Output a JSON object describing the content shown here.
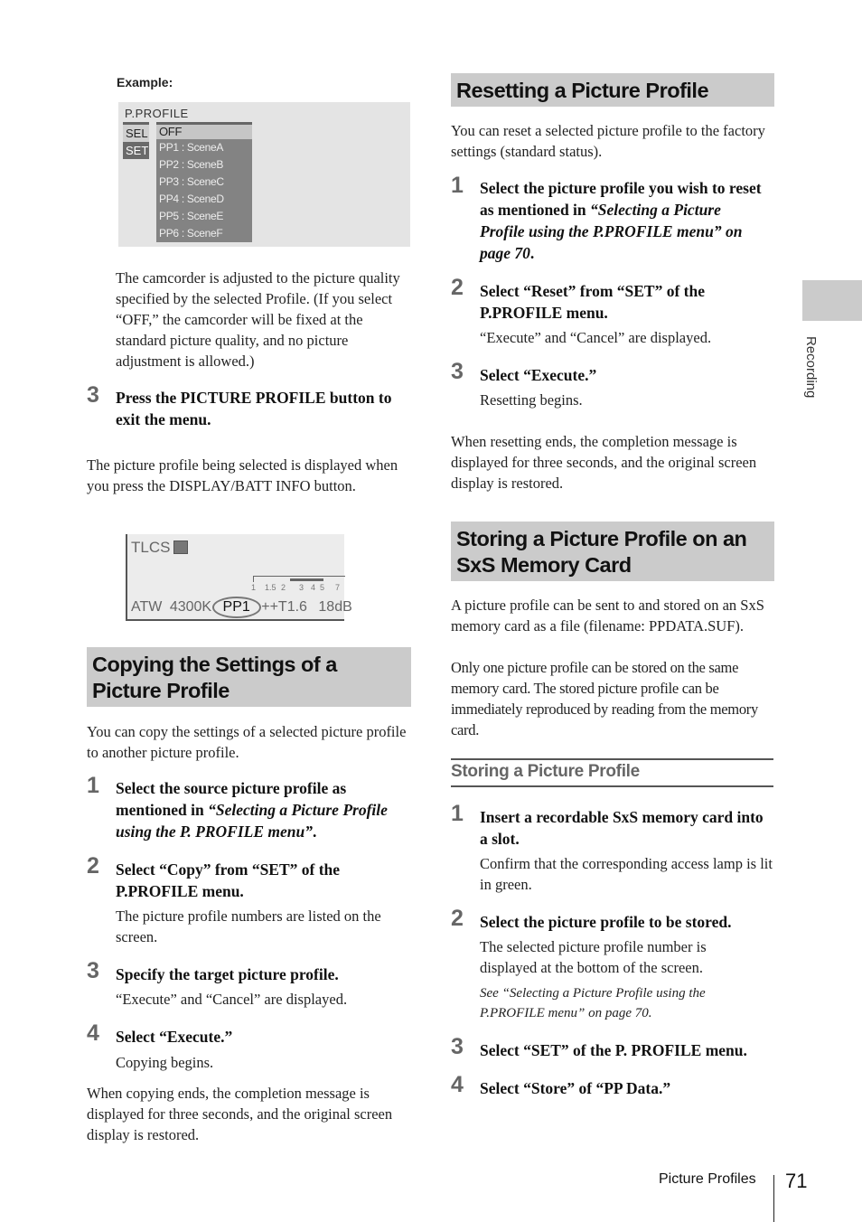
{
  "example": {
    "label": "Example:",
    "menu": {
      "title": "P.PROFILE",
      "tabs": [
        "SEL",
        "SET"
      ],
      "items": [
        "OFF",
        "PP1 : SceneA",
        "PP2 : SceneB",
        "PP3 : SceneC",
        "PP4 : SceneD",
        "PP5 : SceneE",
        "PP6 : SceneF"
      ]
    }
  },
  "left": {
    "para1": "The camcorder is adjusted to the picture quality specified by the selected Profile. (If you select “OFF,” the camcorder will be fixed at the standard picture quality, and no picture adjustment is allowed.)",
    "step3": {
      "num": "3",
      "title": "Press the PICTURE PROFILE button to exit the menu."
    },
    "para2": "The picture profile being selected is displayed when you press the DISPLAY/BATT INFO button.",
    "lcd": {
      "top": "TLCS",
      "scale": [
        "1",
        "1.5",
        "2",
        "3",
        "4",
        "5",
        "7"
      ],
      "bottom": [
        "ATW",
        "4300K",
        "PP1",
        "++T1.6",
        "18dB"
      ]
    },
    "copy_section": {
      "heading": "Copying the Settings of a Picture Profile",
      "intro": "You can copy the settings of a selected picture profile to another picture profile.",
      "steps": [
        {
          "num": "1",
          "title_plain": "Select the source picture profile as mentioned in ",
          "title_italic": "“Selecting a Picture Profile using the P. PROFILE menu”",
          "title_end": "."
        },
        {
          "num": "2",
          "title": "Select “Copy” from “SET” of the P.PROFILE menu.",
          "note": "The picture profile numbers are listed on the screen."
        },
        {
          "num": "3",
          "title": "Specify the target picture profile.",
          "note": "“Execute” and “Cancel” are displayed."
        },
        {
          "num": "4",
          "title": "Select “Execute.”",
          "note": "Copying begins."
        }
      ],
      "outro": "When copying ends, the completion message is displayed for three seconds, and the original screen display is restored."
    }
  },
  "right": {
    "reset_section": {
      "heading": "Resetting a Picture Profile",
      "intro": "You can reset a selected picture profile to the factory settings (standard status).",
      "steps": [
        {
          "num": "1",
          "title_plain": "Select the picture profile you wish to reset as mentioned in ",
          "title_italic": "“Selecting a Picture Profile using the P.PROFILE menu” on page 70",
          "title_end": "."
        },
        {
          "num": "2",
          "title": "Select “Reset” from “SET” of the P.PROFILE menu.",
          "note": "“Execute” and “Cancel” are displayed."
        },
        {
          "num": "3",
          "title": "Select “Execute.”",
          "note": "Resetting begins."
        }
      ],
      "outro": "When resetting ends, the completion message is displayed for three seconds, and the original screen display is restored."
    },
    "store_section": {
      "heading": "Storing a Picture Profile on an SxS Memory Card",
      "intro1": "A picture profile can be sent to and stored on an SxS memory card as a file (filename: PPDATA.SUF).",
      "intro2": "Only one picture profile can be stored on the same memory card. The stored picture profile can be immediately reproduced by reading from the memory card.",
      "subheading": "Storing a Picture Profile",
      "steps": [
        {
          "num": "1",
          "title": "Insert a recordable SxS memory card into a slot.",
          "note": "Confirm that the corresponding access lamp is lit in green."
        },
        {
          "num": "2",
          "title": "Select the picture profile to be stored.",
          "note": "The selected picture profile number is displayed at the bottom of the screen.",
          "see": "See “Selecting a Picture Profile using the P.PROFILE menu” on page 70."
        },
        {
          "num": "3",
          "title": "Select “SET” of the P. PROFILE menu."
        },
        {
          "num": "4",
          "title": "Select “Store” of “PP Data.”"
        }
      ]
    }
  },
  "side_tab": {
    "label": "Recording"
  },
  "footer": {
    "section": "Picture Profiles",
    "page": "71"
  }
}
